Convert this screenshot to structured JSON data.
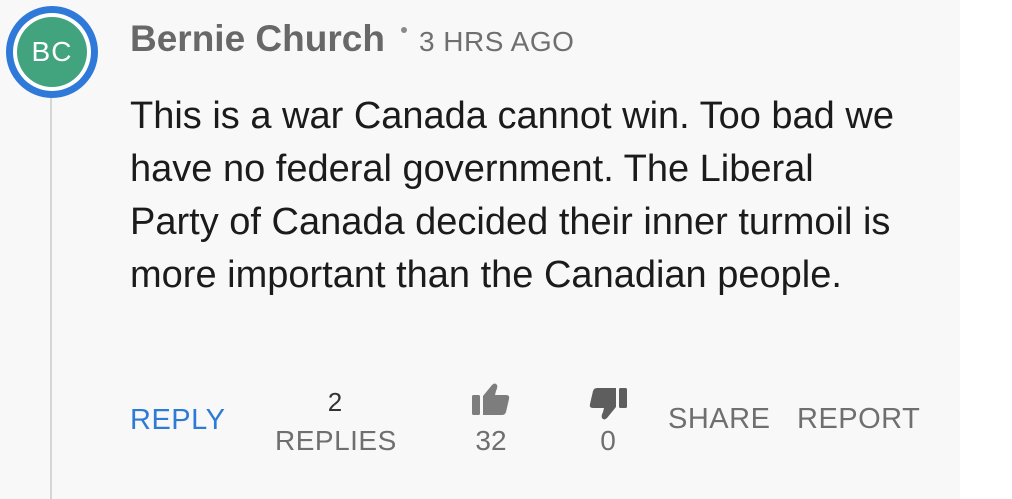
{
  "comment": {
    "avatar_initials": "BC",
    "author": "Bernie Church",
    "timestamp": "3 HRS AGO",
    "text": "This is a war Canada cannot win. Too bad we have no federal government. The Liberal Party of Canada decided their inner turmoil is more important than the Canadian people."
  },
  "actions": {
    "reply_label": "REPLY",
    "replies_count": "2",
    "replies_label": "REPLIES",
    "like_icon": "thumbs-up-icon",
    "like_count": "32",
    "dislike_icon": "thumbs-down-icon",
    "dislike_count": "0",
    "share_label": "SHARE",
    "report_label": "REPORT"
  },
  "colors": {
    "accent_blue": "#2e7bd6",
    "avatar_ring": "#2f7ad8",
    "avatar_fill": "#42a47e",
    "panel_bg": "#f8f8f8",
    "muted_text": "#6f6f6f"
  }
}
